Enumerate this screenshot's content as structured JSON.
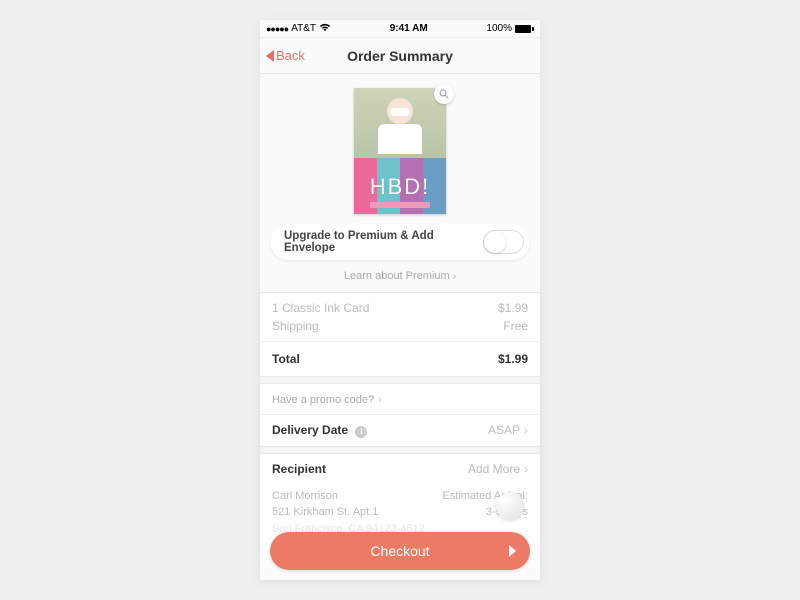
{
  "statusbar": {
    "carrier": "AT&T",
    "time": "9:41 AM",
    "battery": "100%"
  },
  "nav": {
    "back": "Back",
    "title": "Order Summary"
  },
  "card": {
    "text": "HBD!"
  },
  "premium": {
    "label": "Upgrade to Premium & Add Envelope",
    "learn": "Learn about Premium"
  },
  "order": {
    "line1_label": "1 Classic Ink Card",
    "line1_price": "$1.99",
    "line2_label": "Shipping",
    "line2_price": "Free",
    "total_label": "Total",
    "total_price": "$1.99"
  },
  "promo": {
    "label": "Have a promo code?"
  },
  "delivery": {
    "label": "Delivery Date",
    "value": "ASAP"
  },
  "recipient": {
    "header": "Recipient",
    "add_more": "Add More",
    "name": "Carl Morrison",
    "addr1": "521 Kirkham St. Apt 1",
    "addr2": "San Francisco, CA 94123-4512",
    "eta_label": "Estimated Arrival:",
    "eta_value": "3-5 days"
  },
  "checkout": {
    "label": "Checkout"
  }
}
